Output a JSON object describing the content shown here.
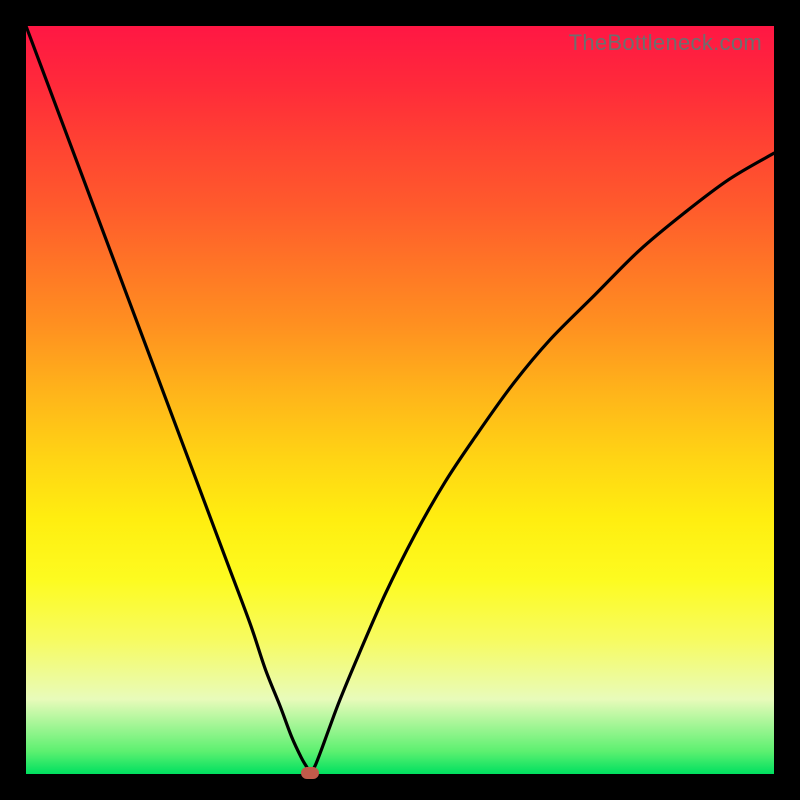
{
  "watermark": "TheBottleneck.com",
  "colors": {
    "curve_stroke": "#000000",
    "marker_fill": "#c15a4a"
  },
  "chart_data": {
    "type": "line",
    "title": "",
    "xlabel": "",
    "ylabel": "",
    "xlim": [
      0,
      100
    ],
    "ylim": [
      0,
      100
    ],
    "series": [
      {
        "name": "bottleneck-curve",
        "x": [
          0,
          3,
          6,
          9,
          12,
          15,
          18,
          21,
          24,
          27,
          30,
          32,
          34,
          35.5,
          36.8,
          37.5,
          38,
          38.6,
          39.4,
          40.5,
          42,
          44.5,
          48,
          52,
          56,
          60,
          65,
          70,
          76,
          82,
          88,
          94,
          100
        ],
        "y": [
          100,
          92,
          84,
          76,
          68,
          60,
          52,
          44,
          36,
          28,
          20,
          14,
          9,
          5,
          2.2,
          1,
          0.2,
          1,
          3,
          6,
          10,
          16,
          24,
          32,
          39,
          45,
          52,
          58,
          64,
          70,
          75,
          79.5,
          83
        ]
      }
    ],
    "marker": {
      "x": 38,
      "y": 0.2
    },
    "grid": false,
    "legend": false
  }
}
